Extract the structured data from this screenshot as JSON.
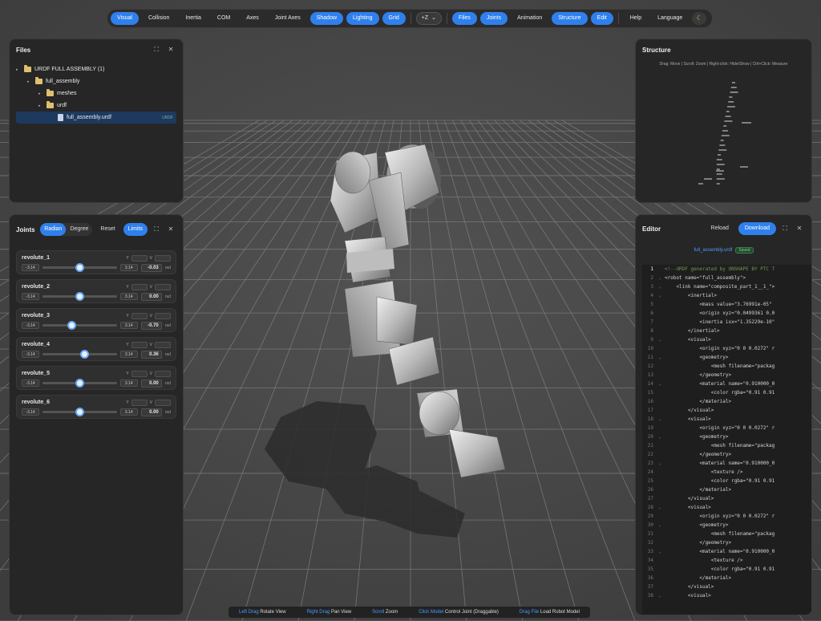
{
  "toolbar": {
    "buttons_left": [
      {
        "label": "Visual",
        "on": true
      },
      {
        "label": "Collision",
        "on": false
      },
      {
        "label": "Inertia",
        "on": false
      },
      {
        "label": "COM",
        "on": false
      },
      {
        "label": "Axes",
        "on": false
      },
      {
        "label": "Joint Axes",
        "on": false
      },
      {
        "label": "Shadow",
        "on": true
      },
      {
        "label": "Lighting",
        "on": true
      },
      {
        "label": "Grid",
        "on": true
      }
    ],
    "up_axis": "+Z",
    "buttons_right": [
      {
        "label": "Files",
        "on": true
      },
      {
        "label": "Joints",
        "on": true
      },
      {
        "label": "Animation",
        "on": false
      },
      {
        "label": "Structure",
        "on": true
      },
      {
        "label": "Edit",
        "on": true
      }
    ],
    "help": "Help",
    "language": "Language"
  },
  "files": {
    "title": "Files",
    "tree": [
      {
        "label": "URDF FULL ASSEMBLY (1)",
        "depth": 0,
        "type": "folder",
        "caret": true
      },
      {
        "label": "full_assembly",
        "depth": 1,
        "type": "folder",
        "caret": true
      },
      {
        "label": "meshes",
        "depth": 2,
        "type": "folder",
        "caret": true
      },
      {
        "label": "urdf",
        "depth": 2,
        "type": "folder",
        "caret": true
      },
      {
        "label": "full_assembly.urdf",
        "depth": 3,
        "type": "file",
        "caret": false,
        "selected": true,
        "tag": "URDF"
      }
    ]
  },
  "joints": {
    "title": "Joints",
    "radian": "Radian",
    "degree": "Degree",
    "reset": "Reset",
    "limits": "Limits",
    "min_label": "Y",
    "max_label": "V",
    "unit": "rad",
    "items": [
      {
        "name": "revolute_1",
        "min": "-3.14",
        "max": "3.14",
        "value": "-0.03",
        "frac": 0.495
      },
      {
        "name": "revolute_2",
        "min": "-3.14",
        "max": "3.14",
        "value": "0.00",
        "frac": 0.5
      },
      {
        "name": "revolute_3",
        "min": "-3.14",
        "max": "3.14",
        "value": "-0.70",
        "frac": 0.389
      },
      {
        "name": "revolute_4",
        "min": "-3.14",
        "max": "3.14",
        "value": "0.36",
        "frac": 0.557
      },
      {
        "name": "revolute_5",
        "min": "-3.14",
        "max": "3.14",
        "value": "0.00",
        "frac": 0.5
      },
      {
        "name": "revolute_6",
        "min": "-3.14",
        "max": "3.14",
        "value": "0.00",
        "frac": 0.5
      }
    ]
  },
  "structure": {
    "title": "Structure",
    "hint": "Drag: Move | Scroll: Zoom | Right-click: Hide/Show | Ctrl+Click: Measure"
  },
  "editor": {
    "title": "Editor",
    "reload": "Reload",
    "download": "Download",
    "filename": "full_assembly.urdf",
    "saved": "Saved",
    "lines": [
      "<!--URDF generated by ONSHAPE BY PTC T",
      "<robot name=\"full_assembly\">",
      "    <link name=\"composite_part_1__1_\">",
      "        <inertial>",
      "            <mass value=\"3.76991e-05\"",
      "            <origin xyz=\"0.0499361 0.0",
      "            <inertia ixx=\"1.35229e-10\"",
      "        </inertial>",
      "        <visual>",
      "            <origin xyz=\"0 0 0.0272\" r",
      "            <geometry>",
      "                <mesh filename=\"packag",
      "            </geometry>",
      "            <material name=\"0.910000_0",
      "                <color rgba=\"0.91 0.91",
      "            </material>",
      "        </visual>",
      "        <visual>",
      "            <origin xyz=\"0 0 0.0272\" r",
      "            <geometry>",
      "                <mesh filename=\"packag",
      "            </geometry>",
      "            <material name=\"0.910000_0",
      "                <texture />",
      "                <color rgba=\"0.91 0.91",
      "            </material>",
      "        </visual>",
      "        <visual>",
      "            <origin xyz=\"0 0 0.0272\" r",
      "            <geometry>",
      "                <mesh filename=\"packag",
      "            </geometry>",
      "            <material name=\"0.910000_0",
      "                <texture />",
      "                <color rgba=\"0.91 0.91",
      "            </material>",
      "        </visual>",
      "        <visual>"
    ]
  },
  "status": [
    {
      "key": "Left Drag",
      "desc": "Rotate View"
    },
    {
      "key": "Right Drag",
      "desc": "Pan View"
    },
    {
      "key": "Scroll",
      "desc": "Zoom"
    },
    {
      "key": "Click Model",
      "desc": "Control Joint (Draggable)"
    },
    {
      "key": "Drag File",
      "desc": "Load Robot Model"
    }
  ],
  "colors": {
    "accent": "#2f80ed",
    "background": "#474747",
    "panel": "#262626"
  }
}
